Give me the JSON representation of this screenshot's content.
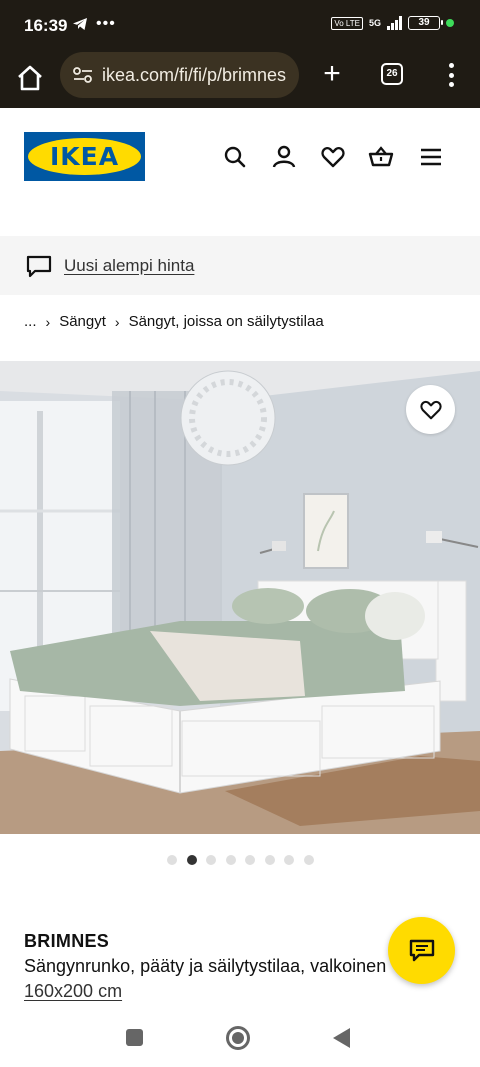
{
  "status_bar": {
    "time": "16:39",
    "left_icons": [
      "telegram-icon",
      "more-dots-icon"
    ],
    "network_label": "5G",
    "volte_label": "Vo LTE",
    "battery": "39"
  },
  "browser": {
    "url": "ikea.com/fi/fi/p/brimnes",
    "tab_count": "26"
  },
  "header": {
    "logo_text": "IKEA",
    "brand_colors": {
      "blue": "#0058a3",
      "yellow": "#ffdb00"
    },
    "icons": [
      "search-icon",
      "account-icon",
      "favourites-icon",
      "basket-icon",
      "hamburger-icon"
    ]
  },
  "price_banner": {
    "label": "Uusi alempi hinta"
  },
  "breadcrumb": {
    "ellipsis": "...",
    "items": [
      "Sängyt",
      "Sängyt, joissa on säilytystilaa"
    ]
  },
  "gallery": {
    "image_count": 8,
    "active_index": 1
  },
  "product": {
    "name": "BRIMNES",
    "description": "Sängynrunko, pääty ja säilytystilaa, valkoinen",
    "size": "160x200 cm"
  }
}
